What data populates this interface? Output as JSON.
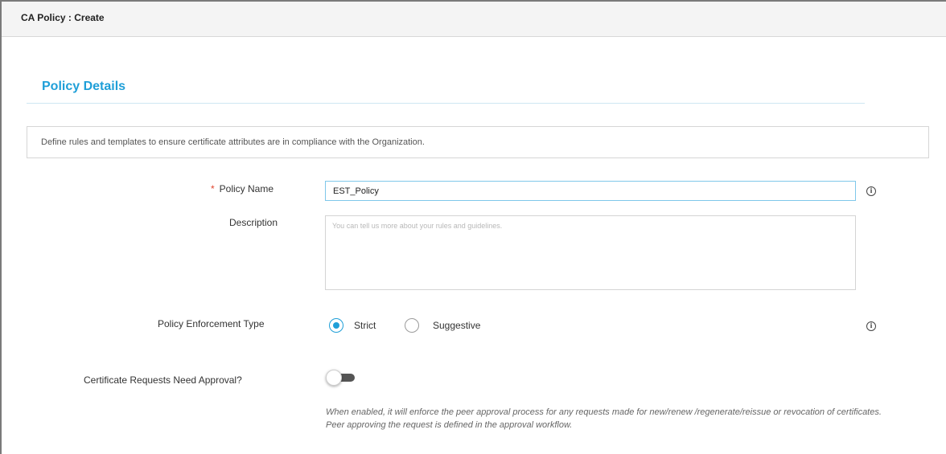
{
  "window": {
    "title": "CA Policy : Create"
  },
  "section": {
    "title": "Policy Details",
    "info": "Define rules and templates to ensure certificate attributes are in compliance with the Organization."
  },
  "form": {
    "policy_name": {
      "required_marker": "*",
      "label": "Policy Name",
      "value": "EST_Policy"
    },
    "description": {
      "label": "Description",
      "placeholder": "You can tell us more about your rules and guidelines."
    },
    "enforcement": {
      "label": "Policy Enforcement Type",
      "options": [
        {
          "label": "Strict",
          "selected": true
        },
        {
          "label": "Suggestive",
          "selected": false
        }
      ]
    },
    "approval": {
      "label": "Certificate Requests Need Approval?",
      "enabled": false,
      "hint": "When enabled, it will enforce the peer approval process for any requests made for new/renew /regenerate/reissue or revocation of certificates. Peer approving the request is defined in the approval workflow."
    }
  },
  "icons": {
    "info": "info-icon"
  },
  "colors": {
    "accent": "#1f9fd8",
    "required": "#e0452f",
    "toggle_off": "#555555"
  }
}
